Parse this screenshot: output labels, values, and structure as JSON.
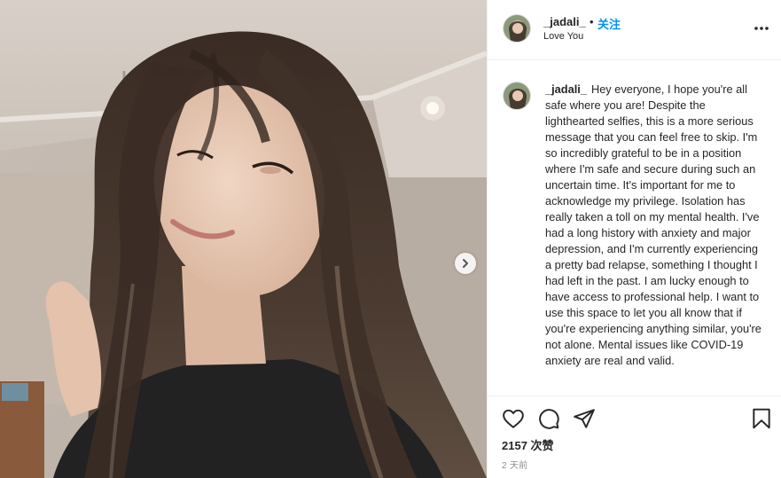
{
  "post": {
    "username": "_jadali_",
    "dot": "•",
    "follow_label": "关注",
    "location": "Love You",
    "caption_username": "_jadali_",
    "caption_text": "Hey everyone, I hope you're all safe where you are! Despite the lighthearted selfies, this is a more serious message that you can feel free to skip. I'm so incredibly grateful to be in a position where I'm safe and secure during such an uncertain time. It's important for me to acknowledge my privilege. Isolation has really taken a toll on my mental health. I've had a long history with anxiety and major depression, and I'm currently experiencing a pretty bad relapse, something I thought I had left in the past. I am lucky enough to have access to professional help. I want to use this space to let you all know that if you're experiencing anything similar, you're not alone. Mental issues like COVID-19 anxiety are real and valid.",
    "likes": "2157 次赞",
    "time_ago": "2 天前"
  },
  "icons": {
    "more": "more-options-icon",
    "like": "heart-icon",
    "comment": "comment-icon",
    "share": "share-icon",
    "save": "bookmark-icon",
    "next": "chevron-right-icon"
  },
  "colors": {
    "follow": "#0095f6",
    "text": "#262626",
    "muted": "#8e8e8e",
    "border": "#efefef"
  }
}
